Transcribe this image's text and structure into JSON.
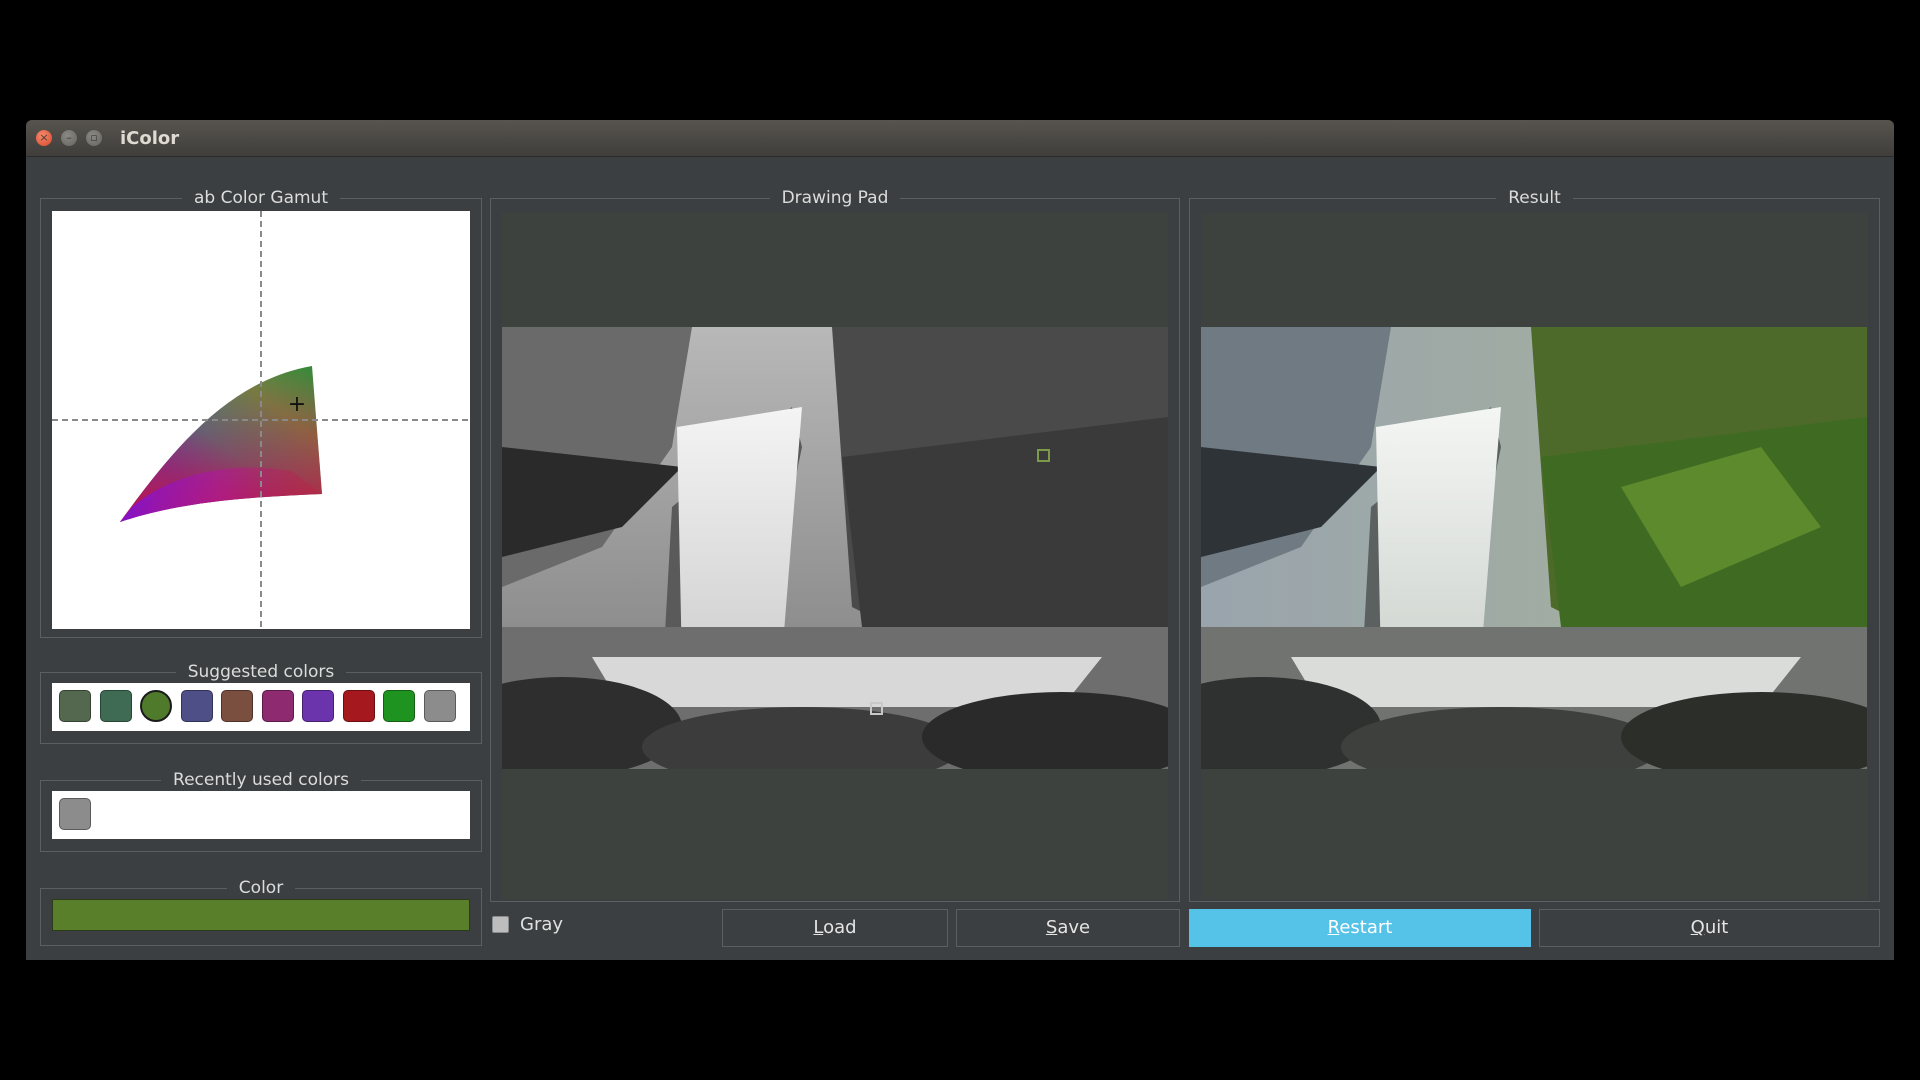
{
  "window": {
    "title": "iColor",
    "close_glyph": "×",
    "minimize_glyph": "–",
    "maximize_glyph": "▫"
  },
  "gamut": {
    "title": "ab Color Gamut",
    "cursor_glyph": "+"
  },
  "suggested": {
    "title": "Suggested colors",
    "colors": [
      "#54684f",
      "#3f6b54",
      "#4f7a2c",
      "#4d4f86",
      "#7a4f3f",
      "#8e2a6f",
      "#6b34ad",
      "#a5181d",
      "#1f931f",
      "#8c8c8c"
    ],
    "selected_index": 2
  },
  "recent": {
    "title": "Recently used colors",
    "colors": [
      "#8c8c8c"
    ]
  },
  "color": {
    "title": "Color",
    "value": "#5a7f2a"
  },
  "drawing_pad": {
    "title": "Drawing Pad",
    "point_colors": [
      "#7c9b4a",
      "#c8c8c8"
    ]
  },
  "result": {
    "title": "Result"
  },
  "controls": {
    "gray_label": "Gray",
    "load_prefix": "",
    "load_underline": "L",
    "load_rest": "oad",
    "save_underline": "S",
    "save_rest": "ave",
    "restart_underline": "R",
    "restart_rest": "estart",
    "quit_underline": "Q",
    "quit_rest": "uit"
  }
}
